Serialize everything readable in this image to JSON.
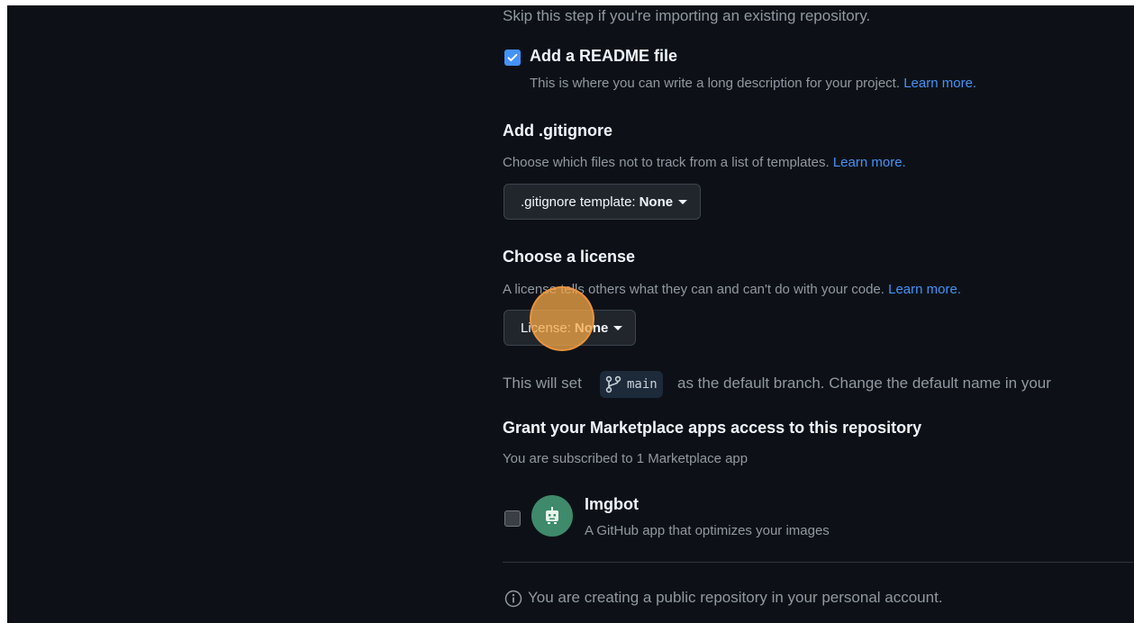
{
  "intro_text": "Skip this step if you're importing an existing repository.",
  "readme": {
    "label": "Add a README file",
    "checked": true,
    "description": "This is where you can write a long description for your project.",
    "learn_more": "Learn more."
  },
  "gitignore": {
    "heading": "Add .gitignore",
    "description": "Choose which files not to track from a list of templates.",
    "learn_more": "Learn more.",
    "button_prefix": ".gitignore template:",
    "button_value": "None"
  },
  "license": {
    "heading": "Choose a license",
    "description": "A license tells others what they can and can't do with your code.",
    "learn_more": "Learn more.",
    "button_prefix": "License:",
    "button_value": "None"
  },
  "branch_note": {
    "prefix": "This will set",
    "branch": "main",
    "suffix": "as the default branch. Change the default name in your"
  },
  "marketplace": {
    "heading": "Grant your Marketplace apps access to this repository",
    "subtitle": "You are subscribed to 1 Marketplace app",
    "apps": [
      {
        "name": "Imgbot",
        "description": "A GitHub app that optimizes your images",
        "checked": false
      }
    ]
  },
  "notice": "You are creating a public repository in your personal account.",
  "colors": {
    "background": "#0d1117",
    "link": "#4493f8",
    "checkbox": "#4493f8",
    "avatar": "#3f8a6b",
    "highlight": "#f6a848"
  },
  "icons": {
    "readme_checkbox": "check-icon",
    "branch": "git-branch-icon",
    "app_avatar": "robot-icon",
    "notice": "info-icon"
  }
}
